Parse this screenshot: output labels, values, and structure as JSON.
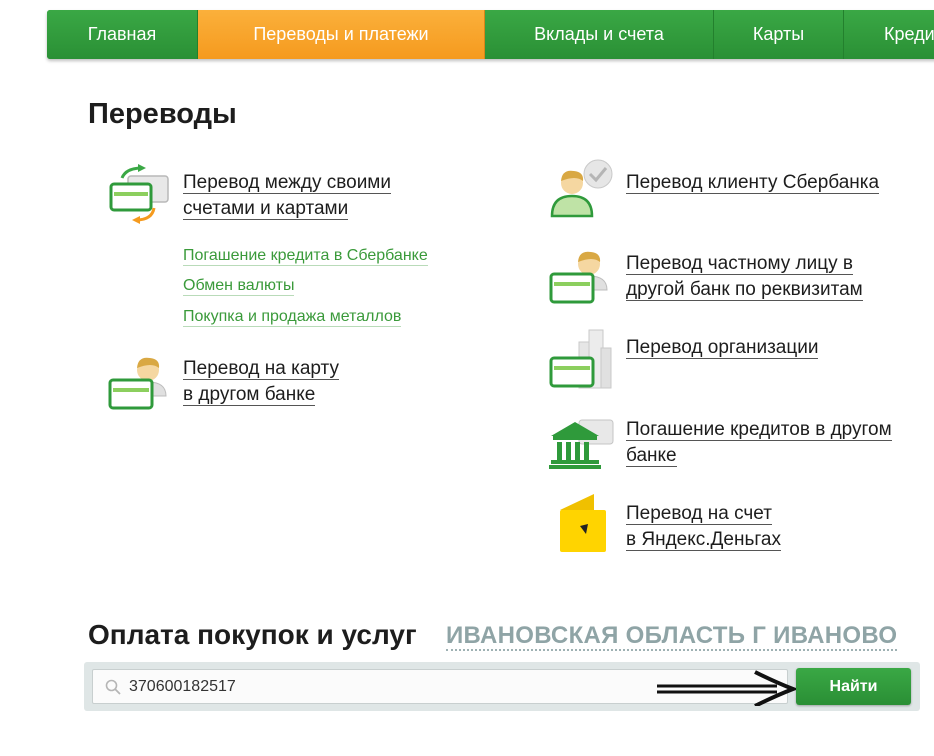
{
  "nav": {
    "items": [
      {
        "label": "Главная"
      },
      {
        "label": "Переводы и платежи",
        "active": true
      },
      {
        "label": "Вклады и счета"
      },
      {
        "label": "Карты"
      },
      {
        "label": "Креди"
      }
    ]
  },
  "transfers": {
    "title": "Переводы",
    "left": {
      "own_accounts": {
        "line1": "Перевод между своими",
        "line2": "счетами и картами",
        "icon": "cards-exchange-icon"
      },
      "sublinks": [
        "Погашение кредита в Сбербанке",
        "Обмен валюты",
        "Покупка и продажа металлов"
      ],
      "card_other_bank": {
        "line1": "Перевод на карту",
        "line2": "в другом банке",
        "icon": "person-card-icon"
      }
    },
    "right": [
      {
        "line1": "Перевод клиенту Сбербанка",
        "line2": "",
        "icon": "sber-client-icon"
      },
      {
        "line1": "Перевод частному лицу в",
        "line2": "другой банк по реквизитам",
        "icon": "person-card-icon"
      },
      {
        "line1": "Перевод организации",
        "line2": "",
        "icon": "organization-icon"
      },
      {
        "line1": "Погашение кредитов в другом",
        "line2": "банке",
        "icon": "bank-building-icon"
      },
      {
        "line1": "Перевод на счет",
        "line2": "в Яндекс.Деньгах",
        "icon": "yandex-wallet-icon"
      }
    ]
  },
  "payments": {
    "title": "Оплата покупок и услуг",
    "region": "ИВАНОВСКАЯ ОБЛАСТЬ Г ИВАНОВО"
  },
  "search": {
    "value": "370600182517",
    "button_label": "Найти"
  },
  "colors": {
    "green": "#2f9a3b",
    "orange": "#f7a325",
    "link_green": "#3a9a3a",
    "region_grey": "#8fa4a6"
  }
}
